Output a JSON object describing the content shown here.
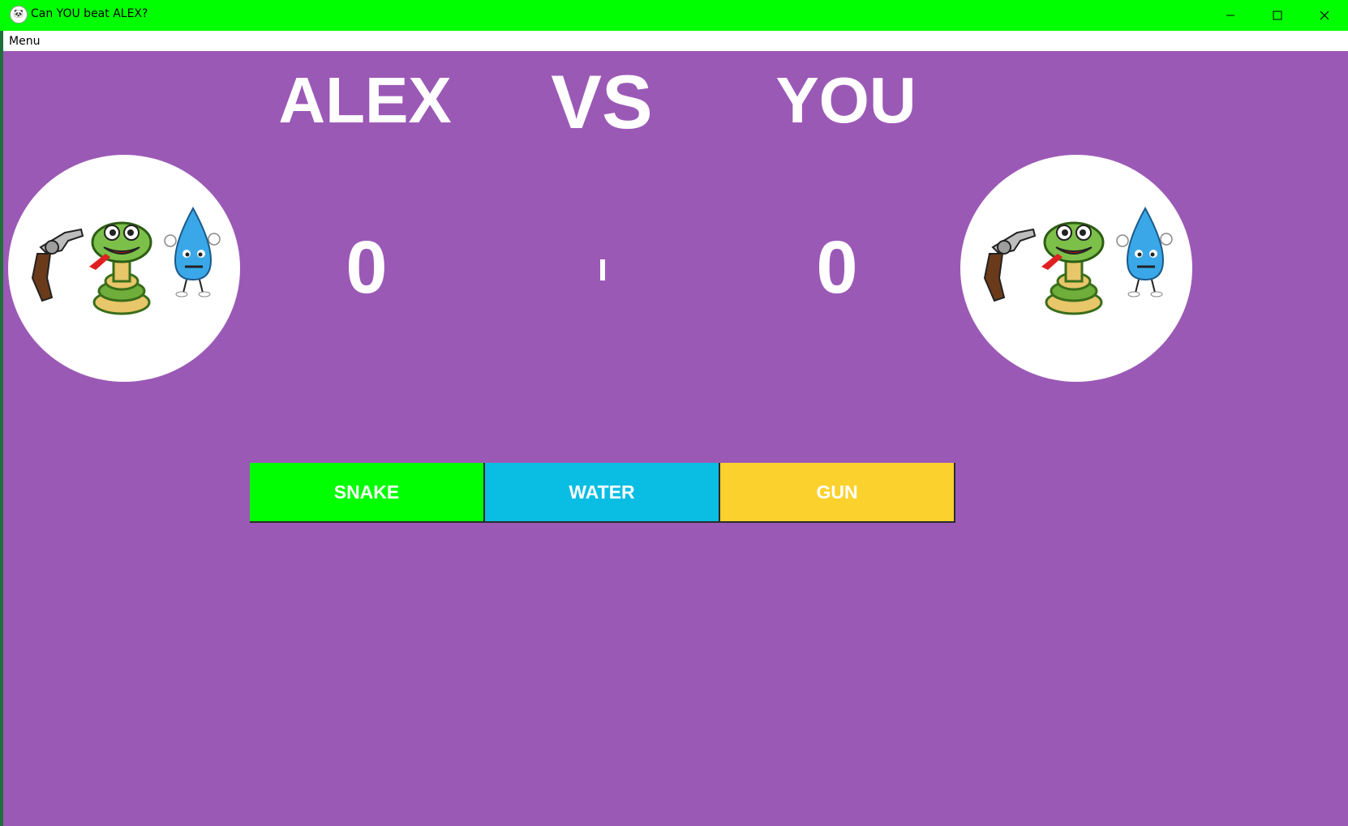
{
  "window": {
    "title": "Can YOU beat ALEX?",
    "titlebar_color": "#00ff00",
    "icon": "panda-icon",
    "controls": [
      "minimize-icon",
      "maximize-icon",
      "close-icon"
    ]
  },
  "menubar": {
    "items": [
      {
        "label": "Menu"
      }
    ]
  },
  "game": {
    "background_color": "#9b59b6",
    "player1_name": "ALEX",
    "versus_label": "VS",
    "player2_name": "YOU",
    "player1_score": "0",
    "player2_score": "0",
    "player1_avatar_icons": [
      "revolver-icon",
      "snake-icon",
      "water-drop-icon"
    ],
    "player2_avatar_icons": [
      "revolver-icon",
      "snake-icon",
      "water-drop-icon"
    ]
  },
  "choices": [
    {
      "label": "SNAKE",
      "color": "#00ff00"
    },
    {
      "label": "WATER",
      "color": "#0abde3"
    },
    {
      "label": "GUN",
      "color": "#fbd12d"
    }
  ]
}
